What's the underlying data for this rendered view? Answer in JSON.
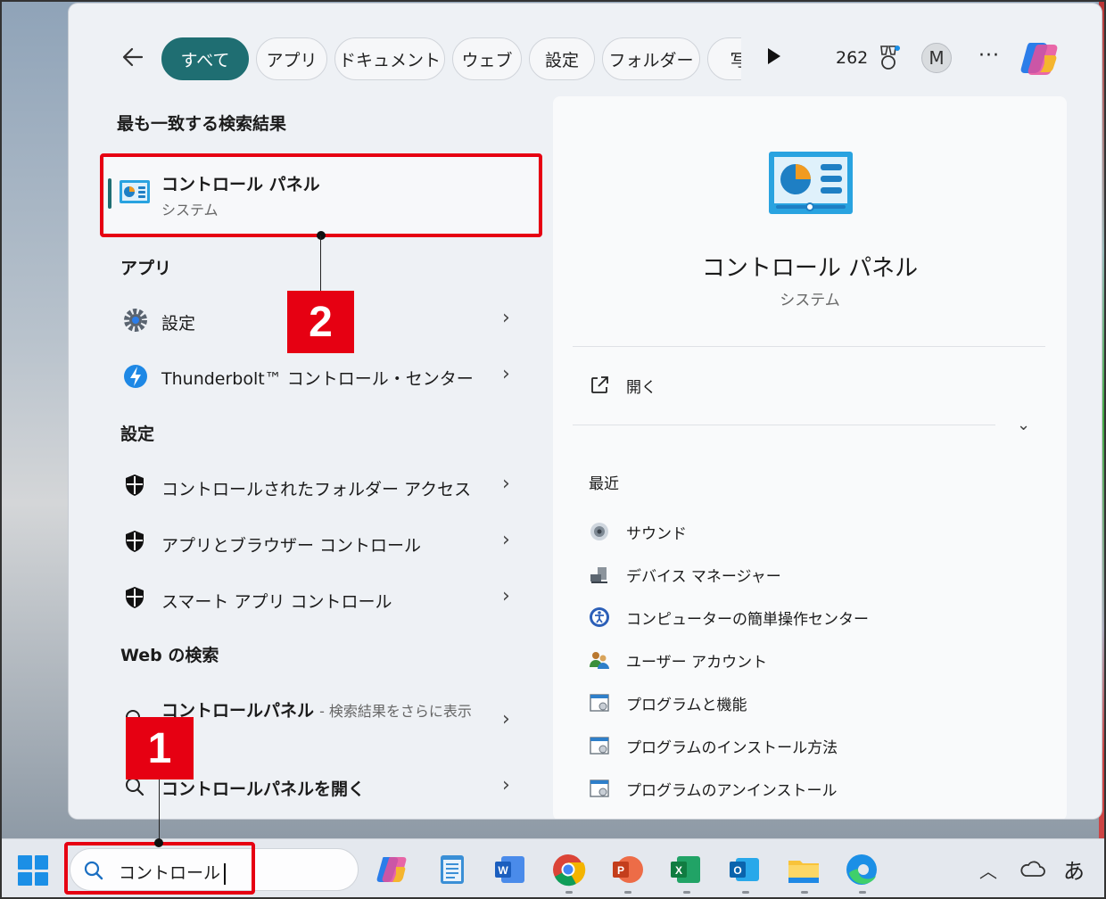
{
  "topbar": {
    "chips": [
      "すべて",
      "アプリ",
      "ドキュメント",
      "ウェブ",
      "設定",
      "フォルダー"
    ],
    "chip_partial": "写",
    "points": "262"
  },
  "avatar_initial": "M",
  "more_label": "···",
  "best_match": {
    "heading": "最も一致する検索結果",
    "title": "コントロール パネル",
    "subtitle": "システム"
  },
  "apps": {
    "heading": "アプリ",
    "items": [
      {
        "label": "設定",
        "icon": "gear-icon"
      },
      {
        "label": "Thunderbolt™ コントロール・センター",
        "icon": "thunderbolt-icon"
      }
    ]
  },
  "settings": {
    "heading": "設定",
    "items": [
      {
        "label": "コントロールされたフォルダー アクセス",
        "icon": "shield-icon"
      },
      {
        "label": "アプリとブラウザー コントロール",
        "icon": "shield-icon"
      },
      {
        "label": "スマート アプリ コントロール",
        "icon": "shield-icon"
      }
    ]
  },
  "web": {
    "heading": "Web の検索",
    "items": [
      {
        "label": "コントロールパネル",
        "hint": "- 検索結果をさらに表示",
        "icon": "search-icon"
      },
      {
        "label": "コントロールパネルを開く",
        "icon": "search-icon"
      }
    ]
  },
  "detail": {
    "title": "コントロール パネル",
    "subtitle": "システム",
    "open_label": "開く",
    "recent_heading": "最近",
    "recent": [
      {
        "label": "サウンド",
        "icon": "speaker-icon"
      },
      {
        "label": "デバイス マネージャー",
        "icon": "device-manager-icon"
      },
      {
        "label": "コンピューターの簡単操作センター",
        "icon": "accessibility-icon"
      },
      {
        "label": "ユーザー アカウント",
        "icon": "users-icon"
      },
      {
        "label": "プログラムと機能",
        "icon": "programs-icon"
      },
      {
        "label": "プログラムのインストール方法",
        "icon": "programs-icon"
      },
      {
        "label": "プログラムのアンインストール",
        "icon": "programs-icon"
      }
    ]
  },
  "taskbar": {
    "search_value": "コントロール",
    "apps": [
      "copilot",
      "notepad",
      "word",
      "chrome",
      "powerpoint",
      "excel",
      "outlook",
      "file-explorer",
      "edge"
    ],
    "ime": "あ"
  },
  "annotations": {
    "badge1": "1",
    "badge2": "2"
  },
  "colors": {
    "accent": "#1f6e72",
    "annotation": "#e60012",
    "windows_blue": "#1b8fe6"
  }
}
